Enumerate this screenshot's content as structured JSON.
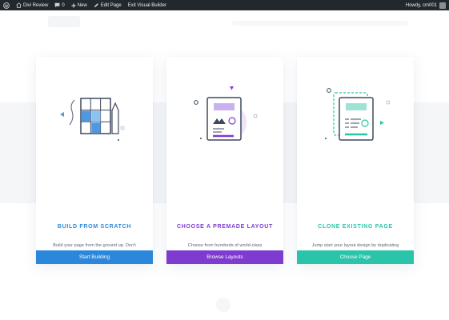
{
  "admin_bar": {
    "site_name": "Divi Review",
    "comments_count": "0",
    "new_label": "New",
    "edit_page_label": "Edit Page",
    "exit_builder_label": "Exit Visual Builder",
    "howdy_label": "Howdy, cm001"
  },
  "cards": [
    {
      "title": "BUILD FROM SCRATCH",
      "description": "Build your page from the ground up. Don't worry, you can access our premade layouts at any time.",
      "button_label": "Start Building",
      "accent": "#2b87da",
      "icon": "grid-blueprint-icon"
    },
    {
      "title": "CHOOSE A PREMADE LAYOUT",
      "description": "Choose from hundreds of world-class premade layouts or start from any of your existing saved layouts.",
      "button_label": "Browse Layouts",
      "accent": "#7e3bd0",
      "icon": "layout-document-icon"
    },
    {
      "title": "CLONE EXISTING PAGE",
      "description": "Jump start your layout design by duplicating another page that you've already built.",
      "button_label": "Choose Page",
      "accent": "#29c4a9",
      "icon": "clone-document-icon"
    }
  ]
}
